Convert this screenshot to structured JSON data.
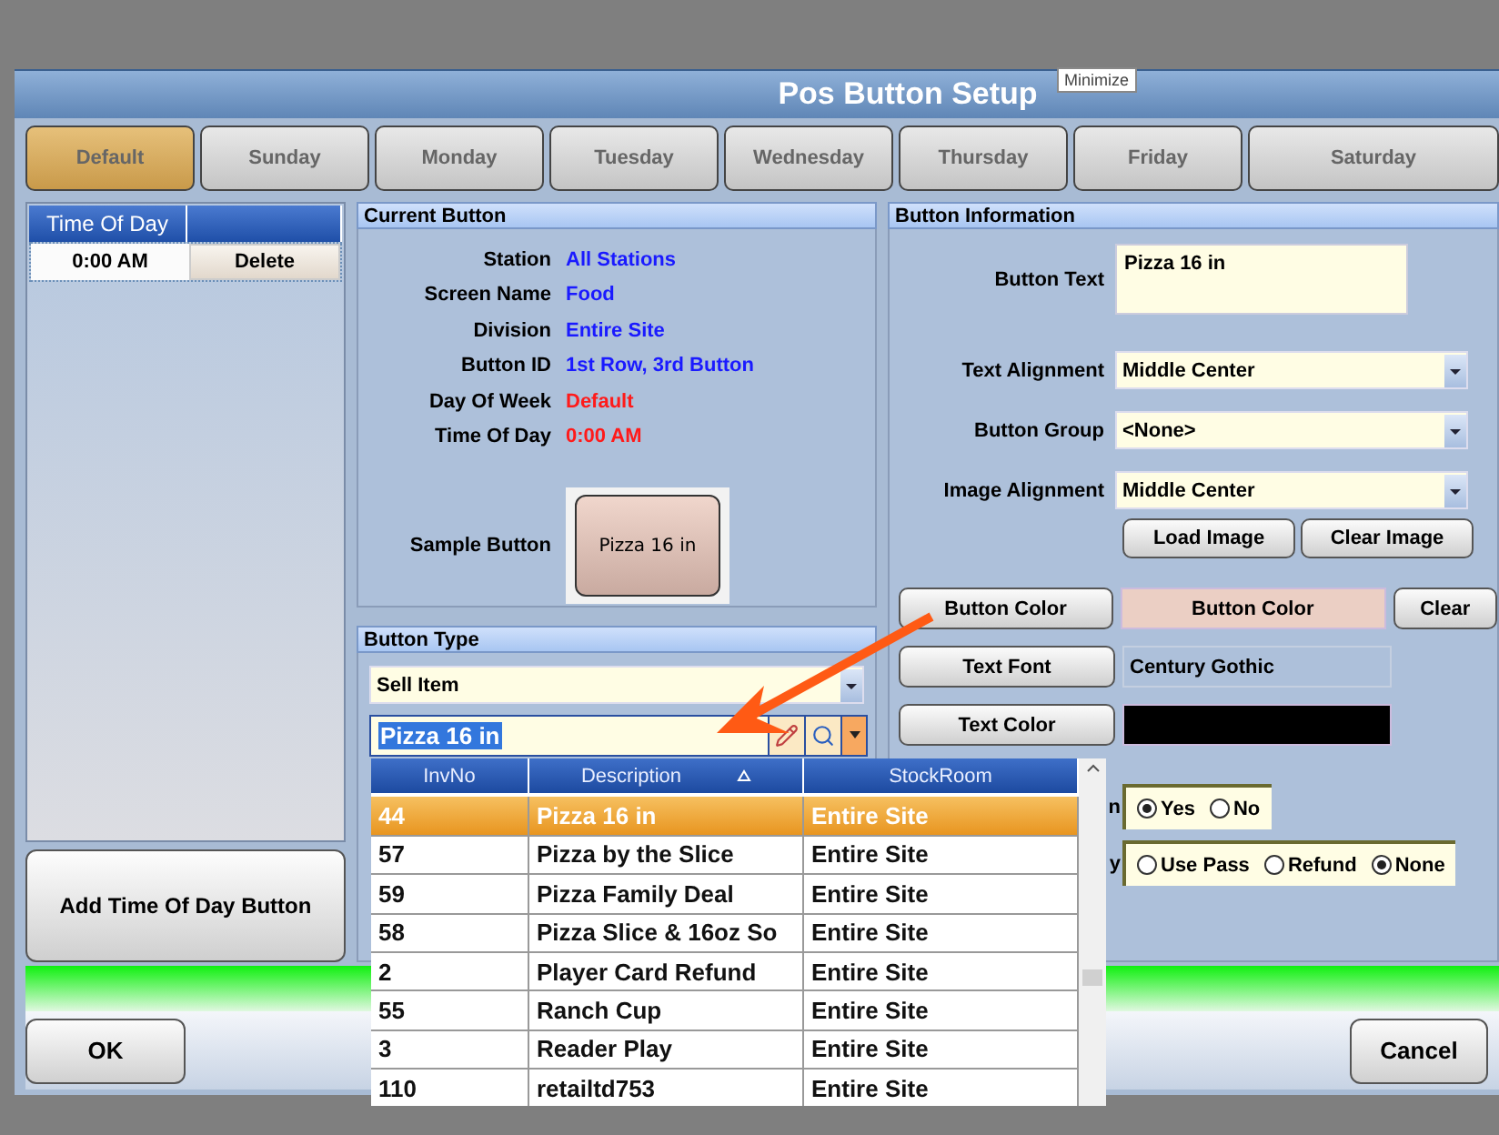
{
  "window": {
    "title": "Pos Button Setup"
  },
  "tooltip": "Minimize",
  "tabs": [
    {
      "label": "Default",
      "selected": true
    },
    {
      "label": "Sunday",
      "selected": false
    },
    {
      "label": "Monday",
      "selected": false
    },
    {
      "label": "Tuesday",
      "selected": false
    },
    {
      "label": "Wednesday",
      "selected": false
    },
    {
      "label": "Thursday",
      "selected": false
    },
    {
      "label": "Friday",
      "selected": false
    },
    {
      "label": "Saturday",
      "selected": false
    }
  ],
  "time_table": {
    "column": "Time Of Day",
    "rows": [
      {
        "time": "0:00 AM",
        "action": "Delete"
      }
    ]
  },
  "add_button": "Add Time Of Day Button",
  "current_button": {
    "title": "Current Button",
    "fields": [
      {
        "label": "Station",
        "value": "All Stations",
        "color": "#1a1aff"
      },
      {
        "label": "Screen Name",
        "value": "Food",
        "color": "#1a1aff"
      },
      {
        "label": "Division",
        "value": "Entire Site",
        "color": "#1a1aff"
      },
      {
        "label": "Button ID",
        "value": "1st Row, 3rd Button",
        "color": "#1a1aff"
      },
      {
        "label": "Day Of Week",
        "value": "Default",
        "color": "#ff1a1a"
      },
      {
        "label": "Time Of Day",
        "value": "0:00 AM",
        "color": "#ff1a1a"
      }
    ],
    "sample_label": "Sample Button",
    "sample_text": "Pizza 16 in"
  },
  "button_type": {
    "title": "Button Type",
    "type_select": "Sell Item",
    "item_input": "Pizza 16 in"
  },
  "item_list": {
    "columns": [
      {
        "label": "InvNo",
        "sorted": false
      },
      {
        "label": "Description",
        "sorted": true
      },
      {
        "label": "StockRoom",
        "sorted": false
      }
    ],
    "rows": [
      {
        "inv": "44",
        "description": "Pizza 16 in",
        "stockroom": "Entire Site",
        "selected": true
      },
      {
        "inv": "57",
        "description": "Pizza by the Slice",
        "stockroom": "Entire Site",
        "selected": false
      },
      {
        "inv": "59",
        "description": "Pizza Family Deal",
        "stockroom": "Entire Site",
        "selected": false
      },
      {
        "inv": "58",
        "description": "Pizza Slice & 16oz So",
        "stockroom": "Entire Site",
        "selected": false
      },
      {
        "inv": "2",
        "description": "Player Card Refund",
        "stockroom": "Entire Site",
        "selected": false
      },
      {
        "inv": "55",
        "description": "Ranch Cup",
        "stockroom": "Entire Site",
        "selected": false
      },
      {
        "inv": "3",
        "description": "Reader Play",
        "stockroom": "Entire Site",
        "selected": false
      },
      {
        "inv": "110",
        "description": "retailtd753",
        "stockroom": "Entire Site",
        "selected": false
      }
    ]
  },
  "button_info": {
    "title": "Button Information",
    "text_label": "Button Text",
    "text_value": "Pizza 16 in",
    "selects": [
      {
        "label": "Text Alignment",
        "value": "Middle Center"
      },
      {
        "label": "Button Group",
        "value": "<None>"
      },
      {
        "label": "Image Alignment",
        "value": "Middle Center"
      }
    ],
    "image_buttons": [
      "Load Image",
      "Clear Image"
    ],
    "button_color": {
      "button": "Button Color",
      "swatch": "Button Color",
      "color": "#ebcfc4",
      "clear": "Clear"
    },
    "text_font": {
      "button": "Text Font",
      "value": "Century Gothic"
    },
    "text_color": {
      "button": "Text Color",
      "color": "#000000"
    },
    "radio_groups": [
      {
        "label": "n",
        "options": [
          {
            "label": "Yes",
            "selected": true
          },
          {
            "label": "No",
            "selected": false
          }
        ]
      },
      {
        "label": "y",
        "options": [
          {
            "label": "Use Pass",
            "selected": false
          },
          {
            "label": "Refund",
            "selected": false
          },
          {
            "label": "None",
            "selected": true
          }
        ]
      }
    ]
  },
  "footer": {
    "ok": "OK",
    "cancel": "Cancel"
  }
}
